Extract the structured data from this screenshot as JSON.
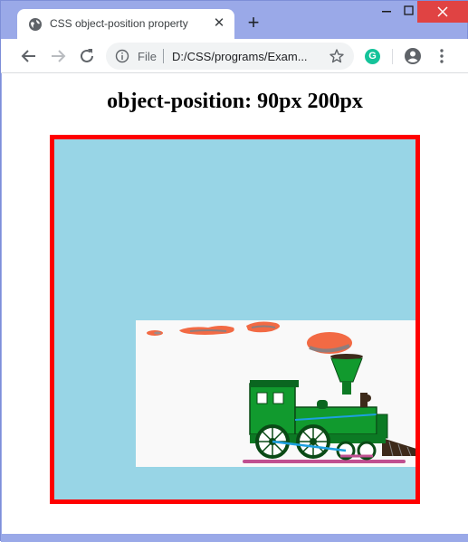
{
  "browser": {
    "tab_title": "CSS object-position property",
    "tab_close": "✕",
    "new_tab": "+",
    "url_scheme": "File",
    "url": "D:/CSS/programs/Exam...",
    "extension_letter": "G"
  },
  "page": {
    "heading": "object-position: 90px 200px"
  },
  "colors": {
    "box_background": "#98d5e6",
    "box_border": "#ff0000",
    "window_frame": "#9aa9e8"
  },
  "image": {
    "object_position": "90px 200px"
  }
}
